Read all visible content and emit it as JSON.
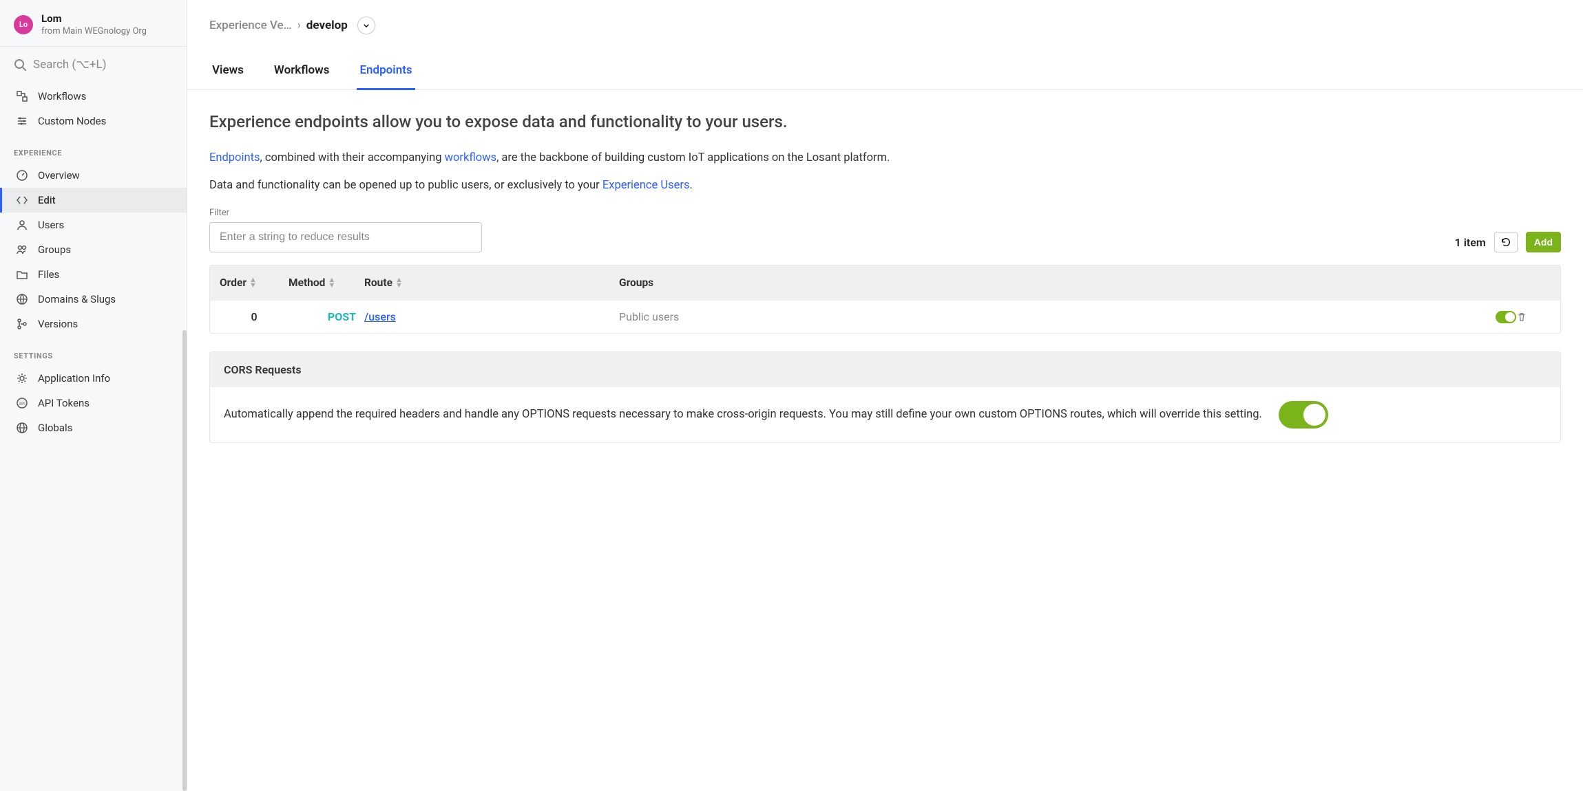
{
  "sidebar": {
    "avatar_initials": "Lo",
    "title": "Lom",
    "subtitle": "from Main WEGnology Org",
    "search_placeholder": "Search (⌥+L)",
    "sections": [
      {
        "heading": null,
        "items": [
          {
            "id": "workflows",
            "label": "Workflows",
            "icon": "workflow-icon"
          },
          {
            "id": "custom-nodes",
            "label": "Custom Nodes",
            "icon": "sliders-icon"
          }
        ]
      },
      {
        "heading": "EXPERIENCE",
        "items": [
          {
            "id": "overview",
            "label": "Overview",
            "icon": "gauge-icon"
          },
          {
            "id": "edit",
            "label": "Edit",
            "icon": "code-icon",
            "active": true
          },
          {
            "id": "users",
            "label": "Users",
            "icon": "user-icon"
          },
          {
            "id": "groups",
            "label": "Groups",
            "icon": "users-icon"
          },
          {
            "id": "files",
            "label": "Files",
            "icon": "folder-icon"
          },
          {
            "id": "domains-slugs",
            "label": "Domains & Slugs",
            "icon": "globe-grid-icon"
          },
          {
            "id": "versions",
            "label": "Versions",
            "icon": "branch-icon"
          }
        ]
      },
      {
        "heading": "SETTINGS",
        "items": [
          {
            "id": "app-info",
            "label": "Application Info",
            "icon": "gear-icon"
          },
          {
            "id": "api-tokens",
            "label": "API Tokens",
            "icon": "api-icon"
          },
          {
            "id": "globals",
            "label": "Globals",
            "icon": "globe-icon"
          }
        ]
      }
    ]
  },
  "breadcrumb": {
    "parent": "Experience Ve…",
    "current": "develop"
  },
  "tabs": [
    {
      "id": "views",
      "label": "Views"
    },
    {
      "id": "workflows",
      "label": "Workflows"
    },
    {
      "id": "endpoints",
      "label": "Endpoints",
      "active": true
    }
  ],
  "page": {
    "heading": "Experience endpoints allow you to expose data and functionality to your users.",
    "desc_link1": "Endpoints",
    "desc_text1": ", combined with their accompanying ",
    "desc_link2": "workflows",
    "desc_text2": ", are the backbone of building custom IoT applications on the Losant platform.",
    "desc2_text1": "Data and functionality can be opened up to public users, or exclusively to your ",
    "desc2_link": "Experience Users",
    "desc2_text2": "."
  },
  "filter": {
    "label": "Filter",
    "placeholder": "Enter a string to reduce results",
    "item_count": "1 item",
    "add_label": "Add"
  },
  "table": {
    "columns": {
      "order": "Order",
      "method": "Method",
      "route": "Route",
      "groups": "Groups"
    },
    "rows": [
      {
        "order": "0",
        "method": "POST",
        "route": "/users",
        "groups": "Public users",
        "enabled": true
      }
    ]
  },
  "cors": {
    "title": "CORS Requests",
    "body": "Automatically append the required headers and handle any OPTIONS requests necessary to make cross-origin requests. You may still define your own custom OPTIONS routes, which will override this setting.",
    "enabled": true
  }
}
